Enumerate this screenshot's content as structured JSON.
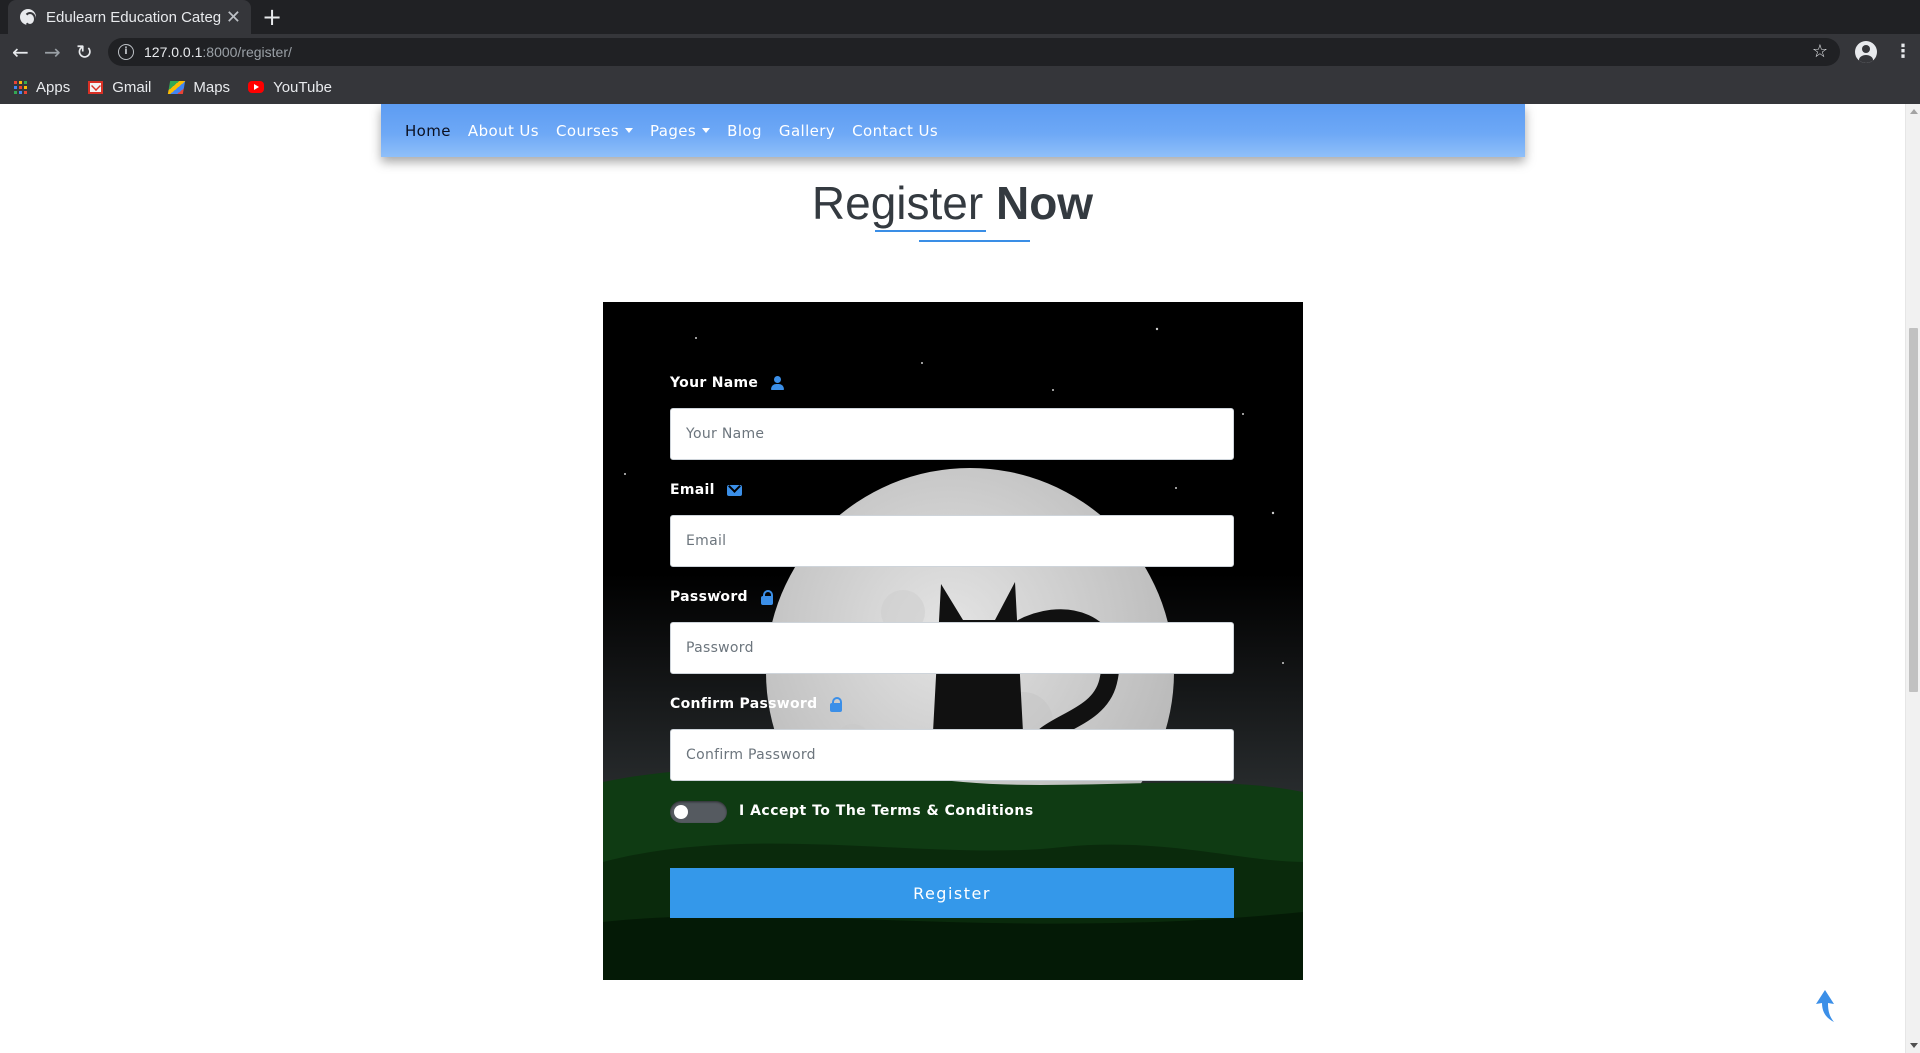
{
  "browser": {
    "tab_title": "Edulearn Education Categ",
    "url_host": "127.0.0.1",
    "url_rest": ":8000/register/",
    "bookmarks": [
      "Apps",
      "Gmail",
      "Maps",
      "YouTube"
    ]
  },
  "navbar": {
    "items": [
      {
        "label": "Home",
        "active": true
      },
      {
        "label": "About Us"
      },
      {
        "label": "Courses",
        "dropdown": true
      },
      {
        "label": "Pages",
        "dropdown": true
      },
      {
        "label": "Blog"
      },
      {
        "label": "Gallery"
      },
      {
        "label": "Contact Us"
      }
    ]
  },
  "heading": {
    "light": "Register",
    "bold": "Now"
  },
  "form": {
    "name_label": "Your Name",
    "name_placeholder": "Your Name",
    "email_label": "Email",
    "email_placeholder": "Email",
    "password_label": "Password",
    "password_placeholder": "Password",
    "confirm_label": "Confirm Password",
    "confirm_placeholder": "Confirm Password",
    "terms_label": "I Accept To The Terms & Conditions",
    "terms_accepted": false,
    "submit_label": "Register"
  },
  "colors": {
    "nav_gradient_top": "#5d9cf2",
    "accent": "#3498ea",
    "icon_blue": "#3b8fe8",
    "heading_text": "#343a40"
  }
}
